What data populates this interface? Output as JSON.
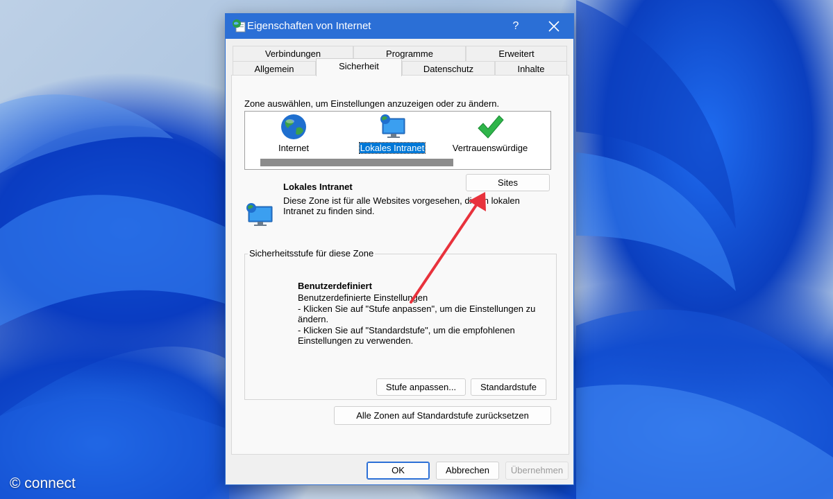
{
  "watermark": "© connect",
  "dialog": {
    "title": "Eigenschaften von Internet",
    "help_glyph": "?",
    "tabs_row1": [
      "Verbindungen",
      "Programme",
      "Erweitert"
    ],
    "tabs_row2": [
      "Allgemein",
      "Sicherheit",
      "Datenschutz",
      "Inhalte"
    ],
    "active_tab": "Sicherheit",
    "zone_prompt": "Zone auswählen, um Einstellungen anzuzeigen oder zu ändern.",
    "zones": [
      {
        "label": "Internet",
        "icon": "globe-icon",
        "selected": false
      },
      {
        "label": "Lokales Intranet",
        "icon": "monitor-globe-icon",
        "selected": true
      },
      {
        "label": "Vertrauenswürdige",
        "icon": "checkmark-icon",
        "selected": false
      }
    ],
    "selected_zone": {
      "title": "Lokales Intranet",
      "description": "Diese Zone ist für alle Websites vorgesehen, die im lokalen Intranet zu finden sind.",
      "sites_button": "Sites"
    },
    "security_level": {
      "group_label": "Sicherheitsstufe für diese Zone",
      "title": "Benutzerdefiniert",
      "lines": [
        "Benutzerdefinierte Einstellungen",
        "- Klicken Sie auf \"Stufe anpassen\", um die Einstellungen zu ändern.",
        "- Klicken Sie auf \"Standardstufe\", um die empfohlenen Einstellungen zu verwenden."
      ],
      "custom_button": "Stufe anpassen...",
      "default_button": "Standardstufe"
    },
    "reset_all_button": "Alle Zonen auf Standardstufe zurücksetzen",
    "footer": {
      "ok": "OK",
      "cancel": "Abbrechen",
      "apply": "Übernehmen"
    }
  },
  "colors": {
    "titlebar": "#2b6fd6",
    "selection": "#0078d7",
    "annotation_arrow": "#e8323c"
  }
}
